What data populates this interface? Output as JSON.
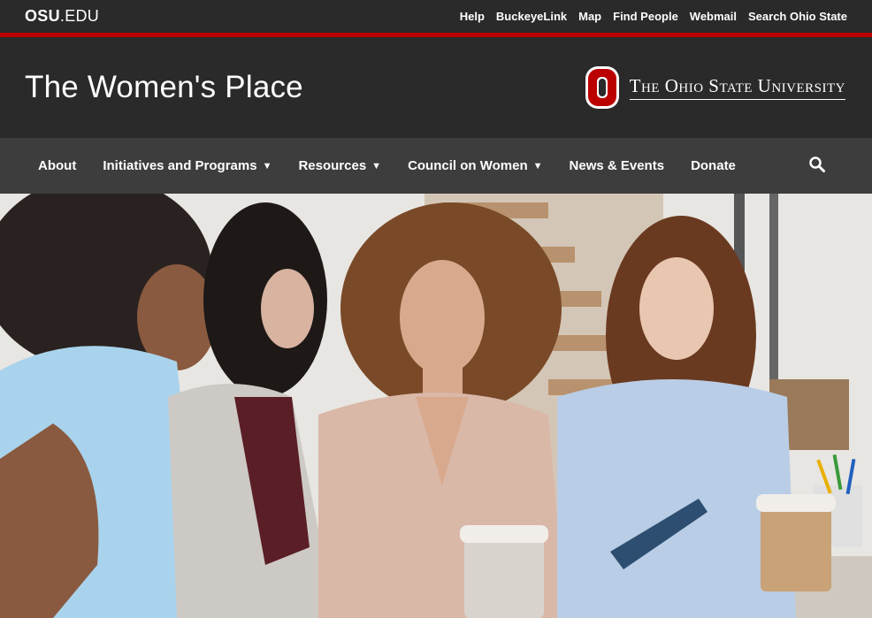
{
  "topbar": {
    "logo_bold": "OSU",
    "logo_rest": ".EDU",
    "links": [
      "Help",
      "BuckeyeLink",
      "Map",
      "Find People",
      "Webmail",
      "Search Ohio State"
    ]
  },
  "header": {
    "site_title": "The Women's Place",
    "university_name": "The Ohio State University"
  },
  "nav": {
    "items": [
      {
        "label": "About",
        "dropdown": false
      },
      {
        "label": "Initiatives and Programs",
        "dropdown": true
      },
      {
        "label": "Resources",
        "dropdown": true
      },
      {
        "label": "Council on Women",
        "dropdown": true
      },
      {
        "label": "News & Events",
        "dropdown": false
      },
      {
        "label": "Donate",
        "dropdown": false
      }
    ],
    "caret": "▼"
  },
  "colors": {
    "scarlet": "#bb0000",
    "dark": "#2a2a2a",
    "nav_bg": "#3d3d3d"
  },
  "icons": {
    "search": "search-icon",
    "block_o": "block-o-logo"
  }
}
